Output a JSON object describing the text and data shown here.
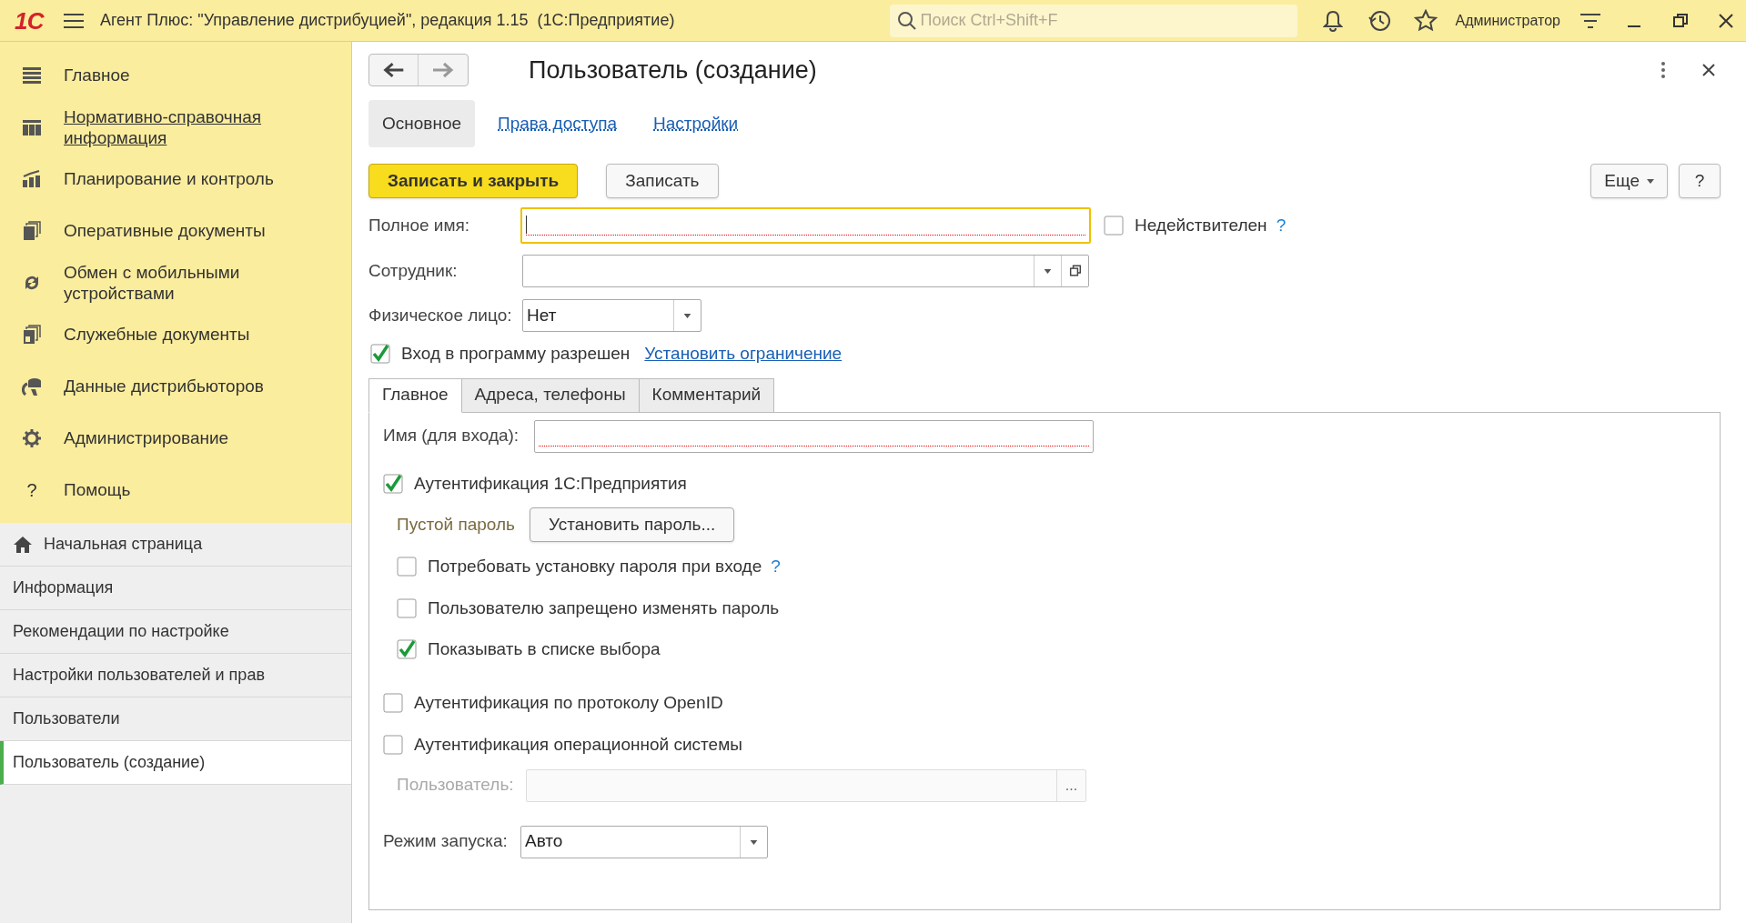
{
  "title_bar": {
    "logo": "1С",
    "title": "Агент Плюс: \"Управление дистрибуцией\", редакция 1.15  (1С:Предприятие)",
    "search": {
      "placeholder": "Поиск Ctrl+Shift+F"
    },
    "user": "Администратор"
  },
  "sidebar": {
    "sections": [
      {
        "label": "Главное",
        "kind": "lines",
        "underlined": false
      },
      {
        "label": "Нормативно-справочная информация",
        "kind": "grid",
        "underlined": true
      },
      {
        "label": "Планирование и контроль",
        "kind": "chart",
        "underlined": false
      },
      {
        "label": "Оперативные документы",
        "kind": "docs",
        "underlined": false
      },
      {
        "label": "Обмен с мобильными устройствами",
        "kind": "sync",
        "underlined": false
      },
      {
        "label": "Служебные документы",
        "kind": "docs2",
        "underlined": false
      },
      {
        "label": "Данные дистрибьюторов",
        "kind": "db",
        "underlined": false
      },
      {
        "label": "Администрирование",
        "kind": "gear",
        "underlined": false
      },
      {
        "label": "Помощь",
        "kind": "help",
        "icon_text": "?",
        "underlined": false
      }
    ],
    "open_windows": [
      {
        "label": "Начальная страница",
        "kind": "home",
        "selected": false
      },
      {
        "label": "Информация",
        "kind": "plain",
        "selected": false
      },
      {
        "label": "Рекомендации по настройке",
        "kind": "plain",
        "selected": false
      },
      {
        "label": "Настройки пользователей и прав",
        "kind": "plain",
        "selected": false
      },
      {
        "label": "Пользователи",
        "kind": "plain",
        "selected": false
      },
      {
        "label": "Пользователь (создание)",
        "kind": "plain",
        "selected": true
      }
    ]
  },
  "form": {
    "title": "Пользователь (создание)",
    "tabs": [
      {
        "label": "Основное",
        "selected": true
      },
      {
        "label": "Права доступа",
        "selected": false
      },
      {
        "label": "Настройки",
        "selected": false
      }
    ],
    "buttons": {
      "save_close": "Записать и закрыть",
      "save": "Записать",
      "more": "Еще",
      "help": "?"
    },
    "full_name": {
      "label": "Полное имя:",
      "required": true,
      "focused": true
    },
    "invalid": {
      "label": "Недействителен",
      "checked": false,
      "hint": "?"
    },
    "employee": {
      "label": "Сотрудник:"
    },
    "person": {
      "label": "Физическое лицо:",
      "value": "Нет"
    },
    "login_allowed": {
      "label": "Вход в программу разрешен",
      "checked": true,
      "link": "Установить ограничение"
    },
    "inner_tabs": [
      {
        "label": "Главное",
        "selected": true
      },
      {
        "label": "Адреса, телефоны",
        "selected": false
      },
      {
        "label": "Комментарий",
        "selected": false
      }
    ],
    "login_name": {
      "label": "Имя (для входа):",
      "required": true
    },
    "auth_1c": {
      "label": "Аутентификация 1С:Предприятия",
      "checked": true
    },
    "password": {
      "status": "Пустой пароль",
      "button": "Установить пароль..."
    },
    "password_options": [
      {
        "label": "Потребовать установку пароля при входе",
        "checked": false,
        "hint": "?"
      },
      {
        "label": "Пользователю запрещено изменять пароль",
        "checked": false
      },
      {
        "label": "Показывать в списке выбора",
        "checked": true
      }
    ],
    "auth_other": [
      {
        "label": "Аутентификация по протоколу OpenID",
        "checked": false
      },
      {
        "label": "Аутентификация операционной системы",
        "checked": false
      }
    ],
    "os_user": {
      "label": "Пользователь:",
      "button": "...",
      "disabled": true
    },
    "launch_mode": {
      "label": "Режим запуска:",
      "value": "Авто"
    }
  }
}
